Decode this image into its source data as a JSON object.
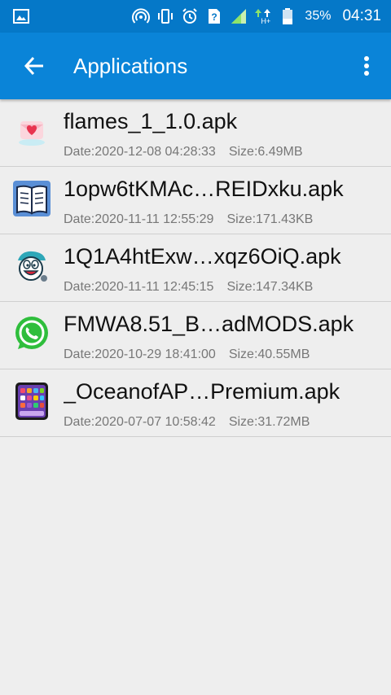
{
  "status_bar": {
    "battery_percent": "35%",
    "time": "04:31",
    "network_type": "H+"
  },
  "app_bar": {
    "title": "Applications"
  },
  "files": [
    {
      "name": "flames_1_1.0.apk",
      "date": "Date:2020-12-08 04:28:33",
      "size": "Size:6.49MB",
      "icon": "heart-envelope-app-icon"
    },
    {
      "name": "1opw6tKMAc…REIDxku.apk",
      "date": "Date:2020-11-11 12:55:29",
      "size": "Size:171.43KB",
      "icon": "open-book-app-icon"
    },
    {
      "name": "1Q1A4htExw…xqz6OiQ.apk",
      "date": "Date:2020-11-11 12:45:15",
      "size": "Size:147.34KB",
      "icon": "cartoon-face-app-icon"
    },
    {
      "name": "FMWA8.51_B…adMODS.apk",
      "date": "Date:2020-10-29 18:41:00",
      "size": "Size:40.55MB",
      "icon": "whatsapp-app-icon"
    },
    {
      "name": "_OceanofAP…Premium.apk",
      "date": "Date:2020-07-07 10:58:42",
      "size": "Size:31.72MB",
      "icon": "phone-launcher-app-icon"
    }
  ],
  "colors": {
    "status_bar": "#0578c8",
    "app_bar": "#0a84d8",
    "background": "#eeeeee",
    "whatsapp_green": "#2fbe3c"
  }
}
